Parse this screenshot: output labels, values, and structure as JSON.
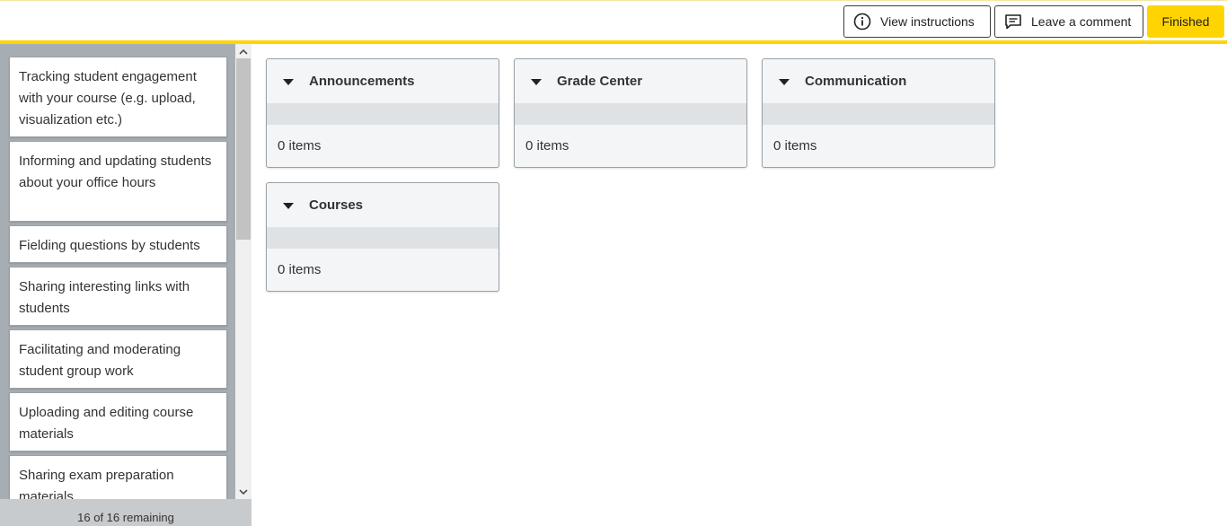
{
  "header": {
    "view_instructions_label": "View instructions",
    "leave_comment_label": "Leave a comment",
    "finished_label": "Finished",
    "accent_color": "#ffd400"
  },
  "sidebar": {
    "cards": [
      "Tracking student engagement with your course (e.g. upload, visualization etc.)",
      "Informing and updating students about your office hours",
      "Fielding questions by students",
      "Sharing interesting links with students",
      "Facilitating and moderating student group work",
      "Uploading and editing course materials",
      "Sharing exam preparation materials"
    ],
    "remaining_text": "16 of 16 remaining"
  },
  "categories": [
    {
      "title": "Announcements",
      "count": "0 items"
    },
    {
      "title": "Grade Center",
      "count": "0 items"
    },
    {
      "title": "Communication",
      "count": "0 items"
    },
    {
      "title": "Courses",
      "count": "0 items"
    }
  ]
}
